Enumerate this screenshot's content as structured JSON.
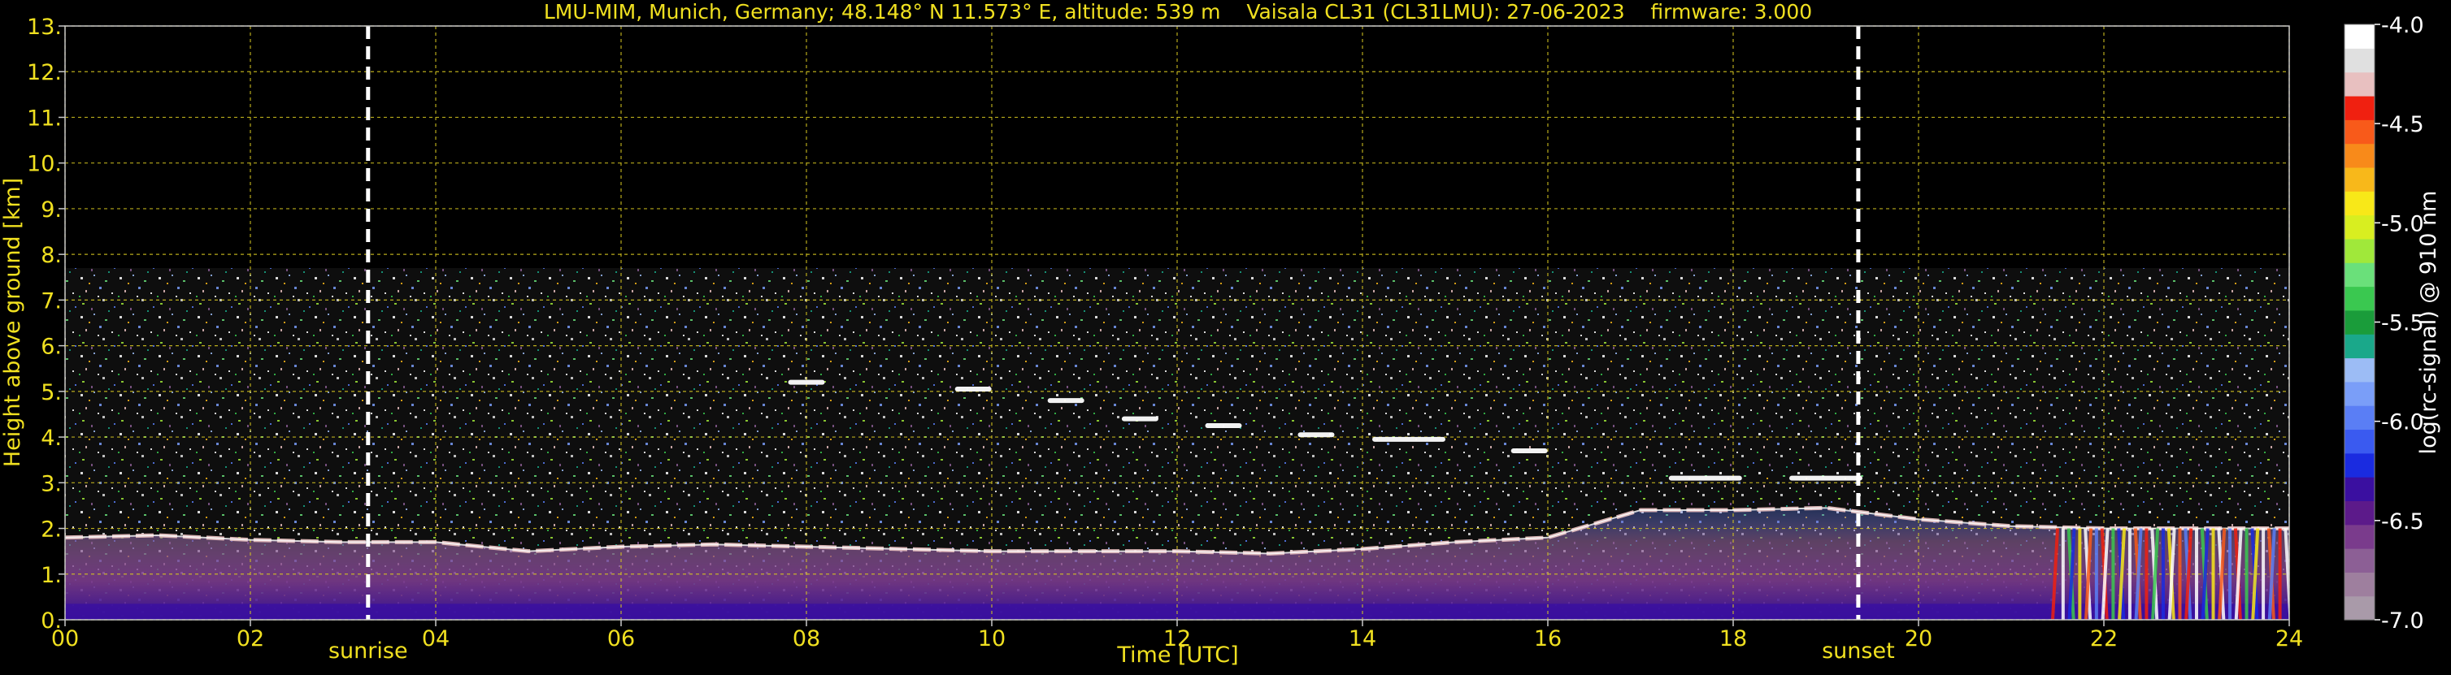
{
  "chart_data": {
    "type": "heatmap",
    "title": "LMU-MIM, Munich, Germany; 48.148° N 11.573° E, altitude: 539 m    Vaisala CL31 (CL31LMU): 27-06-2023    firmware: 3.000",
    "xlabel": "Time [UTC]",
    "ylabel": "Height above ground [km]",
    "xlim": [
      0,
      24
    ],
    "ylim": [
      0,
      13
    ],
    "x_ticks": [
      0,
      2,
      4,
      6,
      8,
      10,
      12,
      14,
      16,
      18,
      20,
      22,
      24
    ],
    "x_tick_labels": [
      "00",
      "02",
      "04",
      "06",
      "08",
      "10",
      "12",
      "14",
      "16",
      "18",
      "20",
      "22",
      "24"
    ],
    "y_ticks": [
      0,
      1,
      2,
      3,
      4,
      5,
      6,
      7,
      8,
      9,
      10,
      11,
      12,
      13
    ],
    "y_tick_labels": [
      "0.",
      "1.",
      "2.",
      "3.",
      "4.",
      "5.",
      "6.",
      "7.",
      "8.",
      "9.",
      "10.",
      "11.",
      "12.",
      "13."
    ],
    "grid": true,
    "signal_top_km": 7.7,
    "annotations": [
      {
        "label": "sunrise",
        "x": 3.27
      },
      {
        "label": "sunset",
        "x": 19.35
      }
    ],
    "colorbar": {
      "label": "log(rc-signal) @ 910 nm",
      "range": [
        -7.0,
        -4.0
      ],
      "ticks": [
        -7.0,
        -6.5,
        -6.0,
        -5.5,
        -5.0,
        -4.5,
        -4.0
      ],
      "tick_labels": [
        "-7.0",
        "-6.5",
        "-6.0",
        "-5.5",
        "-5.0",
        "-4.5",
        "-4.0"
      ],
      "colors": [
        "#a99aa9",
        "#9e7f9e",
        "#8c5f95",
        "#7a3b8c",
        "#5c1a8a",
        "#3a0fa0",
        "#1a2be0",
        "#3a5af0",
        "#5a7ef5",
        "#7a9ef8",
        "#9cbcf5",
        "#1aa88a",
        "#1a9c3a",
        "#3ac850",
        "#6ae07a",
        "#a0e83a",
        "#d8ee20",
        "#f8e818",
        "#f8b81a",
        "#f88a1a",
        "#f85a1a",
        "#f02010",
        "#e8c0c0",
        "#e0e0e0",
        "#ffffff"
      ]
    },
    "features": [
      {
        "name": "boundary-layer-top",
        "points": [
          [
            0,
            1.8
          ],
          [
            1,
            1.85
          ],
          [
            2,
            1.75
          ],
          [
            3,
            1.7
          ],
          [
            4,
            1.7
          ],
          [
            5,
            1.5
          ],
          [
            6,
            1.6
          ],
          [
            7,
            1.65
          ],
          [
            8,
            1.6
          ],
          [
            9,
            1.55
          ],
          [
            10,
            1.5
          ],
          [
            11,
            1.5
          ],
          [
            12,
            1.5
          ],
          [
            13,
            1.45
          ],
          [
            14,
            1.55
          ],
          [
            15,
            1.7
          ],
          [
            16,
            1.8
          ],
          [
            17,
            2.4
          ],
          [
            18,
            2.4
          ],
          [
            19,
            2.45
          ],
          [
            20,
            2.2
          ],
          [
            21,
            2.05
          ],
          [
            22,
            2.0
          ],
          [
            23,
            2.0
          ],
          [
            24,
            2.0
          ]
        ]
      },
      {
        "name": "upper-cloud-layer",
        "points": [
          [
            8.0,
            5.2
          ],
          [
            9.8,
            5.05
          ],
          [
            10.8,
            4.8
          ],
          [
            11.6,
            4.4
          ],
          [
            12.5,
            4.25
          ],
          [
            13.5,
            4.05
          ],
          [
            14.5,
            3.95
          ],
          [
            15.8,
            3.7
          ],
          [
            17.7,
            3.1
          ],
          [
            19.0,
            3.1
          ]
        ]
      },
      {
        "name": "precipitation",
        "x_range": [
          21.5,
          24
        ],
        "from_km": 2.0,
        "to_km": 0
      }
    ]
  }
}
